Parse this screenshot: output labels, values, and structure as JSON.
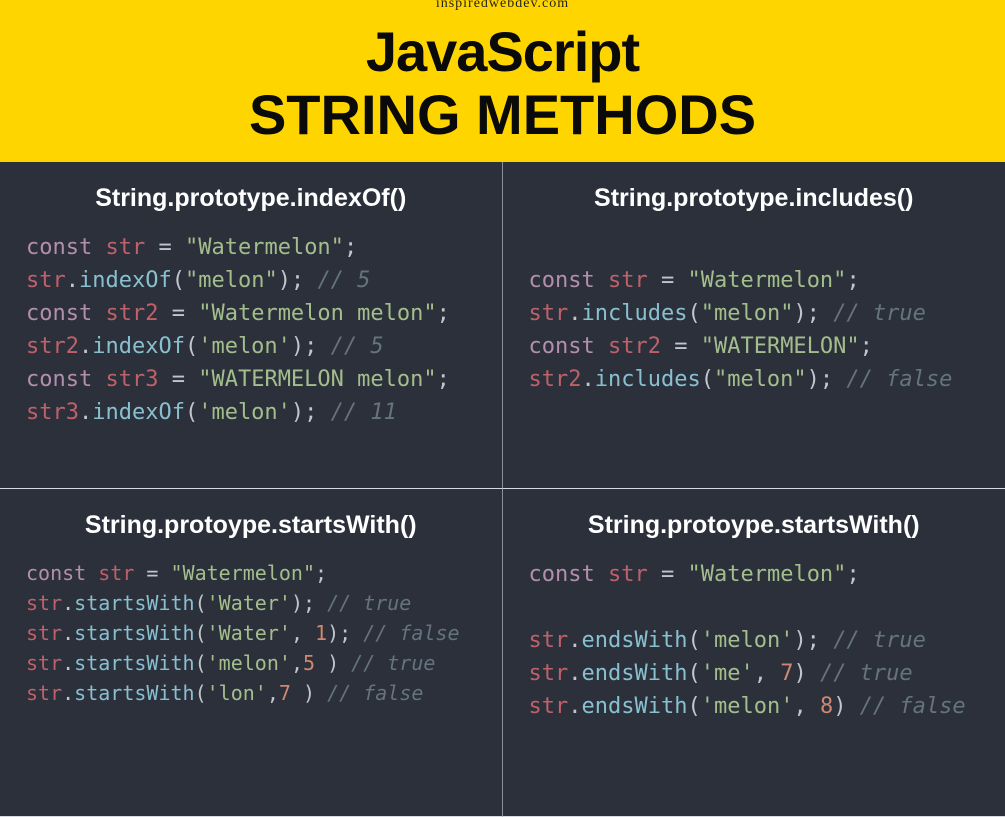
{
  "header": {
    "site": "inspiredwebdev.com",
    "line1": "JavaScript",
    "line2": "STRING METHODS"
  },
  "cells": [
    {
      "title": "String.prototype.indexOf()",
      "codeSize": "normal",
      "lines": [
        [
          {
            "t": "kw",
            "v": "const "
          },
          {
            "t": "var",
            "v": "str"
          },
          {
            "t": "op",
            "v": " = "
          },
          {
            "t": "str",
            "v": "\"Watermelon\""
          },
          {
            "t": "op",
            "v": ";"
          }
        ],
        [
          {
            "t": "var",
            "v": "str"
          },
          {
            "t": "op",
            "v": "."
          },
          {
            "t": "fn",
            "v": "indexOf"
          },
          {
            "t": "op",
            "v": "("
          },
          {
            "t": "str",
            "v": "\"melon\""
          },
          {
            "t": "op",
            "v": "); "
          },
          {
            "t": "cmt",
            "v": "// 5"
          }
        ],
        [
          {
            "t": "kw",
            "v": "const "
          },
          {
            "t": "var",
            "v": "str2"
          },
          {
            "t": "op",
            "v": " = "
          },
          {
            "t": "str",
            "v": "\"Watermelon melon\""
          },
          {
            "t": "op",
            "v": ";"
          }
        ],
        [
          {
            "t": "var",
            "v": "str2"
          },
          {
            "t": "op",
            "v": "."
          },
          {
            "t": "fn",
            "v": "indexOf"
          },
          {
            "t": "op",
            "v": "("
          },
          {
            "t": "str",
            "v": "'melon'"
          },
          {
            "t": "op",
            "v": "); "
          },
          {
            "t": "cmt",
            "v": "// 5"
          }
        ],
        [
          {
            "t": "kw",
            "v": "const "
          },
          {
            "t": "var",
            "v": "str3"
          },
          {
            "t": "op",
            "v": " = "
          },
          {
            "t": "str",
            "v": "\"WATERMELON melon\""
          },
          {
            "t": "op",
            "v": ";"
          }
        ],
        [
          {
            "t": "var",
            "v": "str3"
          },
          {
            "t": "op",
            "v": "."
          },
          {
            "t": "fn",
            "v": "indexOf"
          },
          {
            "t": "op",
            "v": "("
          },
          {
            "t": "str",
            "v": "'melon'"
          },
          {
            "t": "op",
            "v": "); "
          },
          {
            "t": "cmt",
            "v": "// 11"
          }
        ]
      ]
    },
    {
      "title": "String.prototype.includes()",
      "codeSize": "normal",
      "lines": [
        [],
        [
          {
            "t": "kw",
            "v": "const "
          },
          {
            "t": "var",
            "v": "str"
          },
          {
            "t": "op",
            "v": " = "
          },
          {
            "t": "str",
            "v": "\"Watermelon\""
          },
          {
            "t": "op",
            "v": ";"
          }
        ],
        [
          {
            "t": "var",
            "v": "str"
          },
          {
            "t": "op",
            "v": "."
          },
          {
            "t": "fn",
            "v": "includes"
          },
          {
            "t": "op",
            "v": "("
          },
          {
            "t": "str",
            "v": "\"melon\""
          },
          {
            "t": "op",
            "v": "); "
          },
          {
            "t": "cmt",
            "v": "// true"
          }
        ],
        [
          {
            "t": "kw",
            "v": "const "
          },
          {
            "t": "var",
            "v": "str2"
          },
          {
            "t": "op",
            "v": " = "
          },
          {
            "t": "str",
            "v": "\"WATERMELON\""
          },
          {
            "t": "op",
            "v": ";"
          }
        ],
        [
          {
            "t": "var",
            "v": "str2"
          },
          {
            "t": "op",
            "v": "."
          },
          {
            "t": "fn",
            "v": "includes"
          },
          {
            "t": "op",
            "v": "("
          },
          {
            "t": "str",
            "v": "\"melon\""
          },
          {
            "t": "op",
            "v": "); "
          },
          {
            "t": "cmt",
            "v": "// false"
          }
        ]
      ]
    },
    {
      "title": "String.protoype.startsWith()",
      "codeSize": "small",
      "lines": [
        [
          {
            "t": "kw",
            "v": "const "
          },
          {
            "t": "var",
            "v": "str"
          },
          {
            "t": "op",
            "v": " = "
          },
          {
            "t": "str",
            "v": "\"Watermelon\""
          },
          {
            "t": "op",
            "v": ";"
          }
        ],
        [
          {
            "t": "var",
            "v": "str"
          },
          {
            "t": "op",
            "v": "."
          },
          {
            "t": "fn",
            "v": "startsWith"
          },
          {
            "t": "op",
            "v": "("
          },
          {
            "t": "str",
            "v": "'Water'"
          },
          {
            "t": "op",
            "v": "); "
          },
          {
            "t": "cmt",
            "v": "// true"
          }
        ],
        [
          {
            "t": "var",
            "v": "str"
          },
          {
            "t": "op",
            "v": "."
          },
          {
            "t": "fn",
            "v": "startsWith"
          },
          {
            "t": "op",
            "v": "("
          },
          {
            "t": "str",
            "v": "'Water'"
          },
          {
            "t": "op",
            "v": ", "
          },
          {
            "t": "num",
            "v": "1"
          },
          {
            "t": "op",
            "v": "); "
          },
          {
            "t": "cmt",
            "v": "// false"
          }
        ],
        [
          {
            "t": "var",
            "v": "str"
          },
          {
            "t": "op",
            "v": "."
          },
          {
            "t": "fn",
            "v": "startsWith"
          },
          {
            "t": "op",
            "v": "("
          },
          {
            "t": "str",
            "v": "'melon'"
          },
          {
            "t": "op",
            "v": ","
          },
          {
            "t": "num",
            "v": "5"
          },
          {
            "t": "op",
            "v": " ) "
          },
          {
            "t": "cmt",
            "v": "// true"
          }
        ],
        [
          {
            "t": "var",
            "v": "str"
          },
          {
            "t": "op",
            "v": "."
          },
          {
            "t": "fn",
            "v": "startsWith"
          },
          {
            "t": "op",
            "v": "("
          },
          {
            "t": "str",
            "v": "'lon'"
          },
          {
            "t": "op",
            "v": ","
          },
          {
            "t": "num",
            "v": "7"
          },
          {
            "t": "op",
            "v": " ) "
          },
          {
            "t": "cmt",
            "v": "// false"
          }
        ]
      ]
    },
    {
      "title": "String.protoype.startsWith()",
      "codeSize": "normal",
      "lines": [
        [
          {
            "t": "kw",
            "v": "const "
          },
          {
            "t": "var",
            "v": "str"
          },
          {
            "t": "op",
            "v": " = "
          },
          {
            "t": "str",
            "v": "\"Watermelon\""
          },
          {
            "t": "op",
            "v": ";"
          }
        ],
        [],
        [
          {
            "t": "var",
            "v": "str"
          },
          {
            "t": "op",
            "v": "."
          },
          {
            "t": "fn",
            "v": "endsWith"
          },
          {
            "t": "op",
            "v": "("
          },
          {
            "t": "str",
            "v": "'melon'"
          },
          {
            "t": "op",
            "v": "); "
          },
          {
            "t": "cmt",
            "v": "// true"
          }
        ],
        [
          {
            "t": "var",
            "v": "str"
          },
          {
            "t": "op",
            "v": "."
          },
          {
            "t": "fn",
            "v": "endsWith"
          },
          {
            "t": "op",
            "v": "("
          },
          {
            "t": "str",
            "v": "'me'"
          },
          {
            "t": "op",
            "v": ", "
          },
          {
            "t": "num",
            "v": "7"
          },
          {
            "t": "op",
            "v": ") "
          },
          {
            "t": "cmt",
            "v": "// true"
          }
        ],
        [
          {
            "t": "var",
            "v": "str"
          },
          {
            "t": "op",
            "v": "."
          },
          {
            "t": "fn",
            "v": "endsWith"
          },
          {
            "t": "op",
            "v": "("
          },
          {
            "t": "str",
            "v": "'melon'"
          },
          {
            "t": "op",
            "v": ", "
          },
          {
            "t": "num",
            "v": "8"
          },
          {
            "t": "op",
            "v": ") "
          },
          {
            "t": "cmt",
            "v": "// false"
          }
        ]
      ]
    }
  ]
}
